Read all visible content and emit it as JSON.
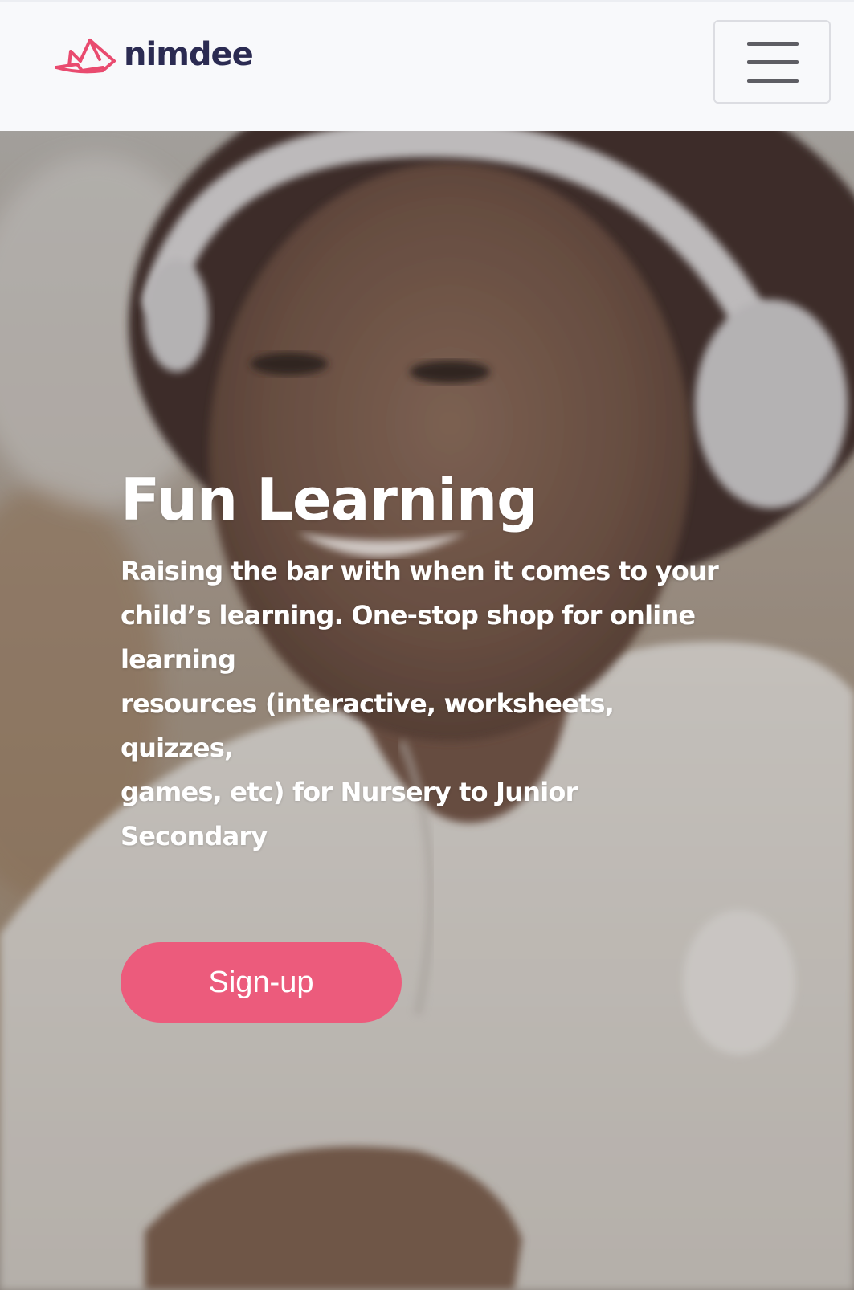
{
  "brand": {
    "name": "nimdee",
    "logo_icon": "crown-boat-logo-icon",
    "logo_color": "#e94b6f",
    "text_color": "#2b2b52"
  },
  "navbar": {
    "menu_icon": "hamburger-menu-icon"
  },
  "hero": {
    "image": "smiling-child-with-headphones-photo",
    "title": "Fun Learning",
    "description": "Raising the bar with when it comes to your child’s learning. One-stop shop for online learning\nresources (interactive, worksheets, quizzes,\ngames, etc) for Nursery to Junior Secondary",
    "signup_label": "Sign-up",
    "button_color": "#ec5b7c"
  }
}
